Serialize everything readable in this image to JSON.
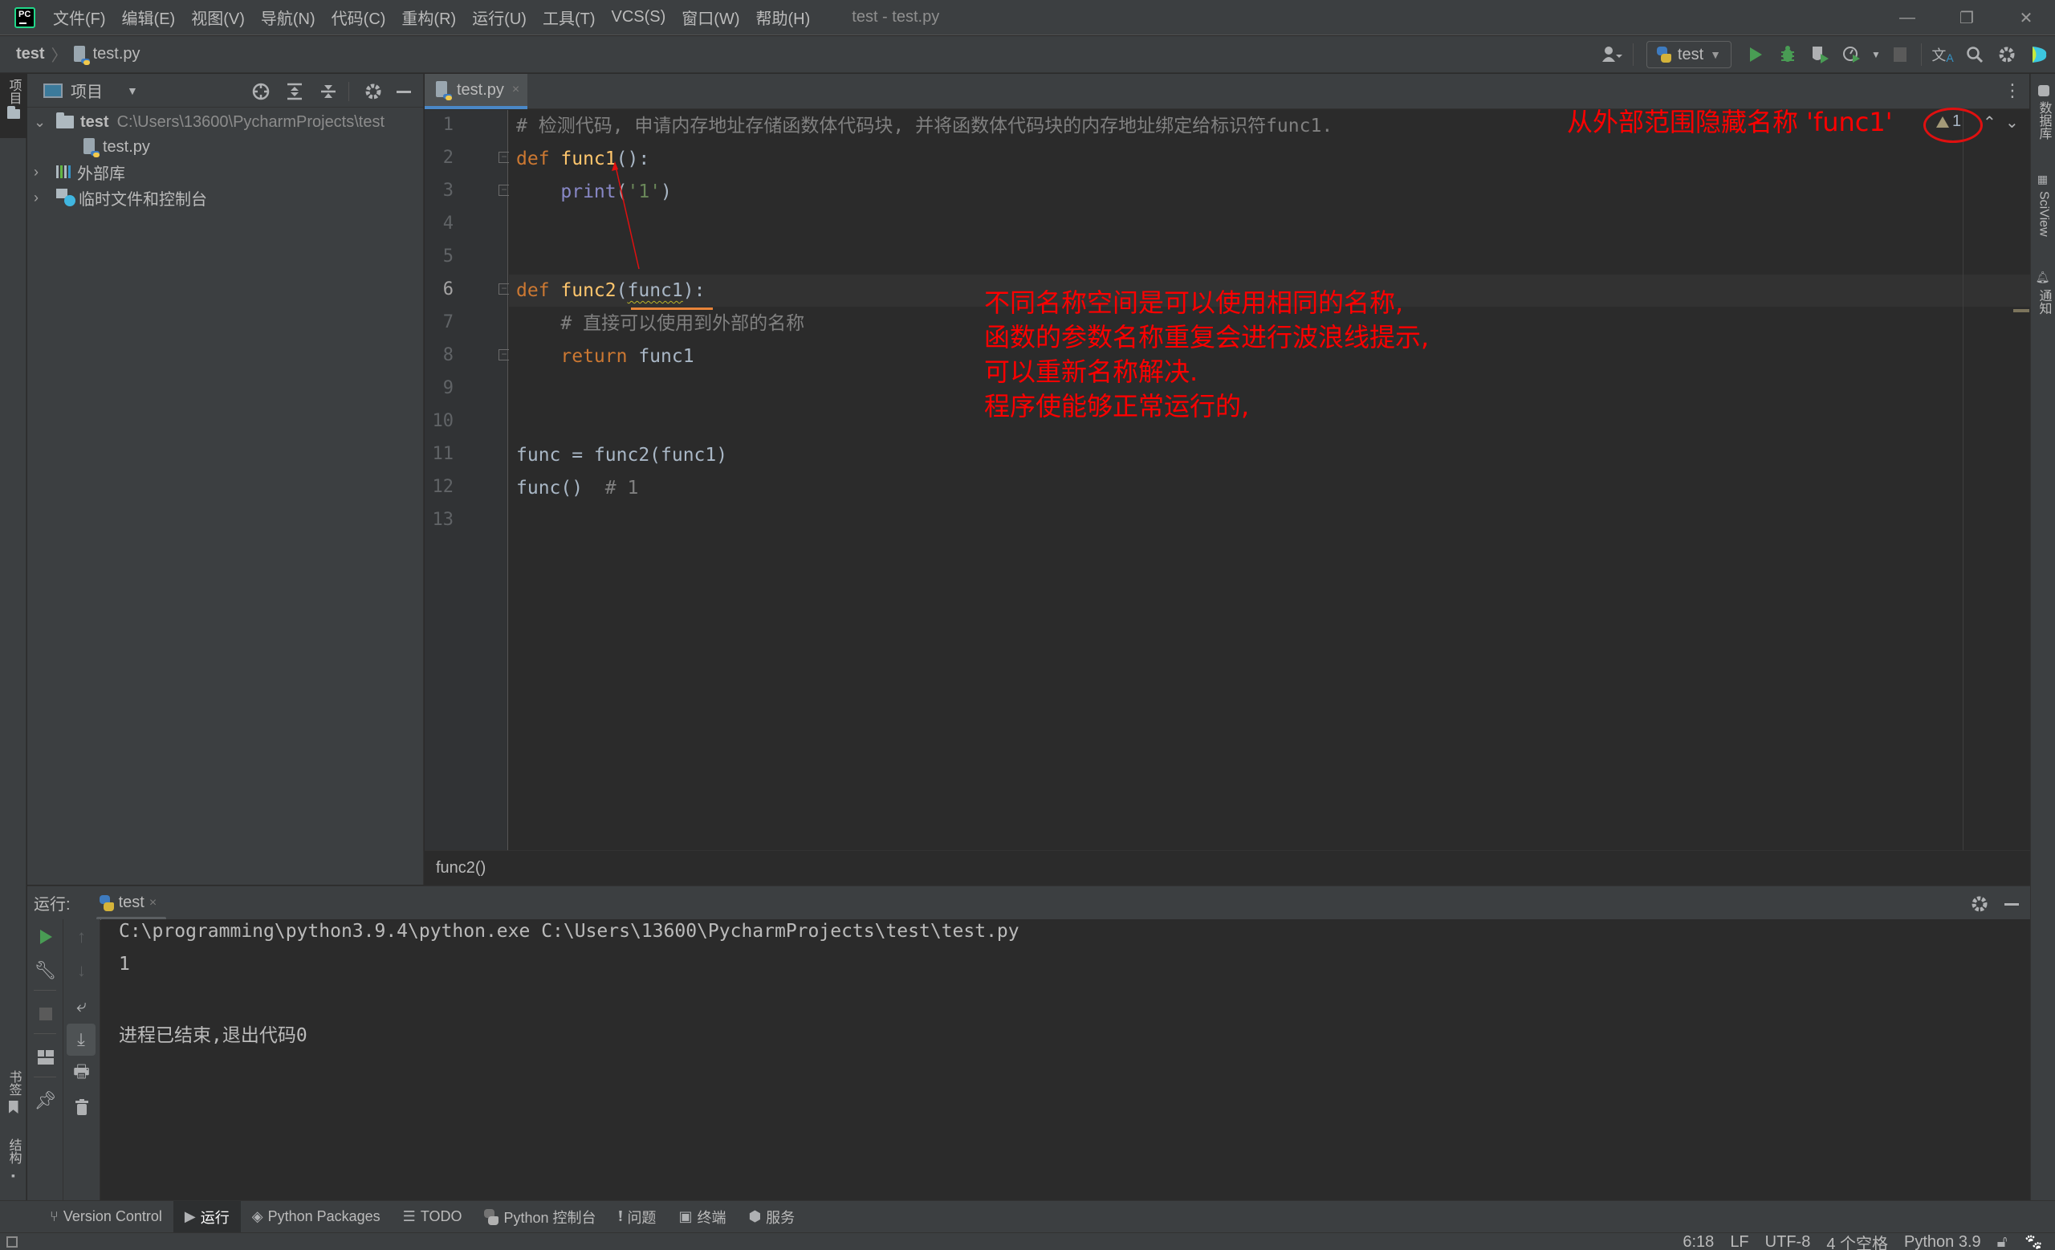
{
  "menubar": {
    "logo": "PC",
    "items": [
      "文件(F)",
      "编辑(E)",
      "视图(V)",
      "导航(N)",
      "代码(C)",
      "重构(R)",
      "运行(U)",
      "工具(T)",
      "VCS(S)",
      "窗口(W)",
      "帮助(H)"
    ],
    "window_title": "test - test.py",
    "minimize": "—",
    "restore": "❐",
    "close": "✕"
  },
  "navbar": {
    "root": "test",
    "separator": "〉",
    "file": "test.py"
  },
  "toolbar": {
    "run_config": "test",
    "icons": [
      "user-icon",
      "run-icon",
      "debug-icon",
      "coverage-icon",
      "profile-icon",
      "stop-icon",
      "translate-icon",
      "search-icon",
      "settings-icon",
      "plugin-icon"
    ]
  },
  "left_stripe": {
    "project": "项目",
    "bookmarks": "书签",
    "structure": "结构"
  },
  "project_panel": {
    "title": "项目",
    "tree": [
      {
        "label": "test",
        "path": "C:\\Users\\13600\\PycharmProjects\\test",
        "expanded": true
      },
      {
        "label": "test.py"
      },
      {
        "label": "外部库",
        "expanded": false
      },
      {
        "label": "临时文件和控制台",
        "expanded": false
      }
    ]
  },
  "editor": {
    "tab": "test.py",
    "tab_close": "×",
    "current_line": 6,
    "lines": [
      "# 检测代码, 申请内存地址存储函数体代码块, 并将函数体代码块的内存地址绑定给标识符func1.",
      "def func1():",
      "    print('1')",
      "",
      "",
      "def func2(func1):",
      "    # 直接可以使用到外部的名称",
      "    return func1",
      "",
      "",
      "func = func2(func1)",
      "func()  # 1",
      ""
    ],
    "breadcrumb": "func2()",
    "warning_count": "1"
  },
  "annotations": {
    "top": "从外部范围隐藏名称 'func1'",
    "body": [
      "不同名称空间是可以使用相同的名称,",
      "函数的参数名称重复会进行波浪线提示,",
      "可以重新名称解决.",
      "程序使能够正常运行的,"
    ],
    "color": "#ff0000"
  },
  "right_stripe": {
    "database": "数据库",
    "sciview": "SciView",
    "notifications": "通知"
  },
  "run_window": {
    "label": "运行:",
    "tab": "test",
    "tab_close": "×",
    "output": [
      "C:\\programming\\python3.9.4\\python.exe C:\\Users\\13600\\PycharmProjects\\test\\test.py",
      "1",
      "",
      "进程已结束,退出代码0"
    ]
  },
  "bottom_tools": [
    {
      "label": "Version Control",
      "icon": "vcs-icon"
    },
    {
      "label": "运行",
      "icon": "run-icon",
      "active": true
    },
    {
      "label": "Python Packages",
      "icon": "packages-icon"
    },
    {
      "label": "TODO",
      "icon": "todo-icon"
    },
    {
      "label": "Python 控制台",
      "icon": "python-console-icon"
    },
    {
      "label": "问题",
      "icon": "problems-icon"
    },
    {
      "label": "终端",
      "icon": "terminal-icon"
    },
    {
      "label": "服务",
      "icon": "services-icon"
    }
  ],
  "statusbar": {
    "position": "6:18",
    "line_sep": "LF",
    "encoding": "UTF-8",
    "indent": "4 个空格",
    "interpreter": "Python 3.9"
  }
}
